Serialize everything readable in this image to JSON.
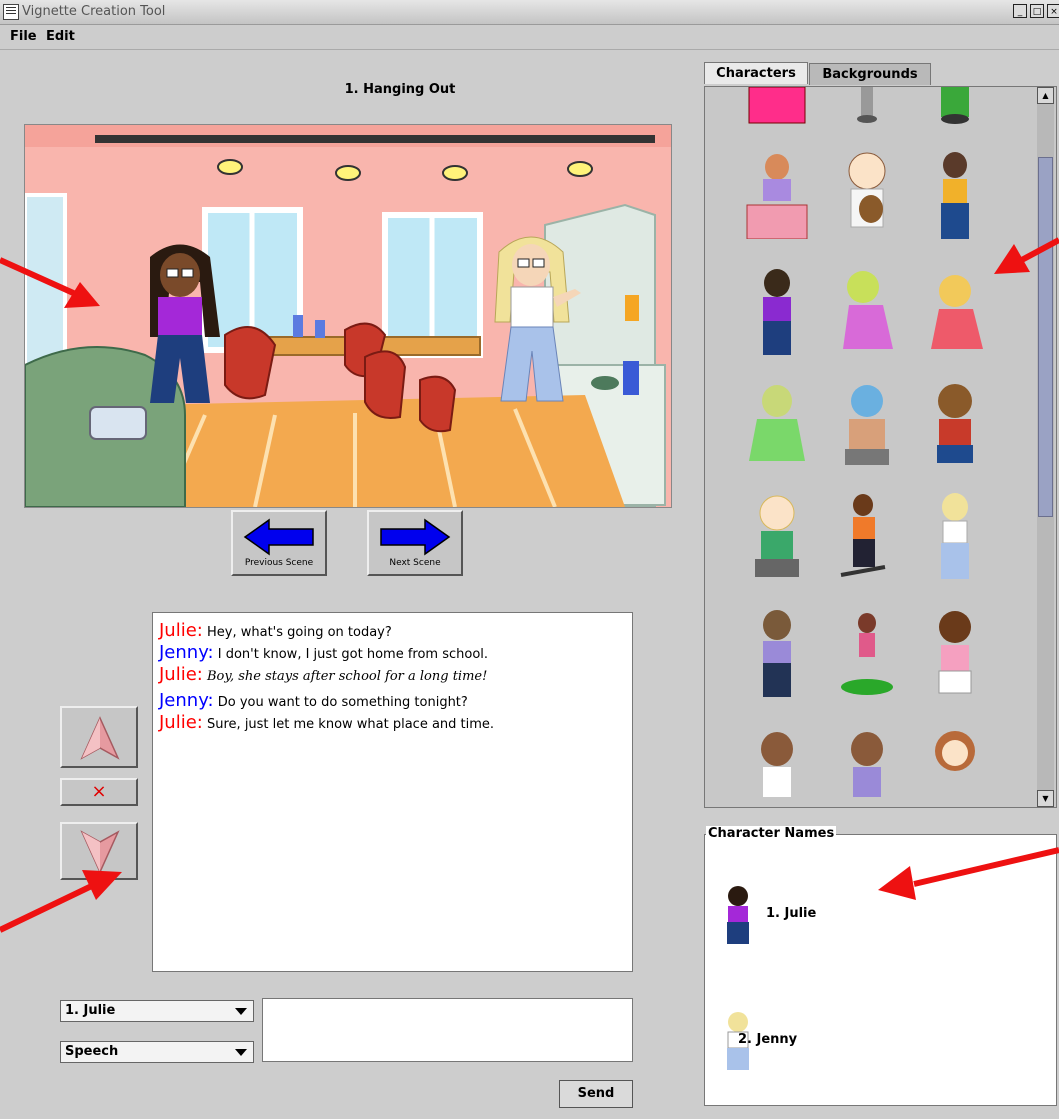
{
  "window": {
    "title": "Vignette Creation Tool",
    "controls": [
      "minimize-icon",
      "maximize-icon",
      "close-icon"
    ]
  },
  "menubar": {
    "file": "File",
    "edit": "Edit"
  },
  "scene": {
    "title": "1. Hanging Out",
    "prev_label": "Previous Scene",
    "next_label": "Next Scene"
  },
  "transcript": {
    "lines": [
      {
        "speaker": "Julie:",
        "text": "Hey, what's going on today?",
        "color": "#ff0000",
        "italic": false
      },
      {
        "speaker": "Jenny:",
        "text": "I don't know, I just got home from school.",
        "color": "#0000ff",
        "italic": false
      },
      {
        "speaker": "Julie:",
        "text": "Boy, she stays after school for a long time!",
        "color": "#ff0000",
        "italic": true
      },
      {
        "speaker": "Jenny:",
        "text": "Do you want to do something tonight?",
        "color": "#0000ff",
        "italic": false
      },
      {
        "speaker": "Julie:",
        "text": "Sure, just let me know what place and time.",
        "color": "#ff0000",
        "italic": false
      }
    ]
  },
  "controls": {
    "move_up_icon": "arrow-up-icon",
    "delete_glyph": "×",
    "move_down_icon": "arrow-down-icon"
  },
  "input": {
    "character_select": "1. Julie",
    "mode_select": "Speech",
    "send_label": "Send"
  },
  "tabs": {
    "characters": "Characters",
    "backgrounds": "Backgrounds",
    "active": "characters"
  },
  "names_panel": {
    "legend": "Character Names",
    "names": [
      "1. Julie",
      "2. Jenny"
    ]
  },
  "colors": {
    "julie": "#ff0000",
    "jenny": "#0000ff",
    "arrow": "#ee1111",
    "nav_arrow": "#0000ee"
  }
}
